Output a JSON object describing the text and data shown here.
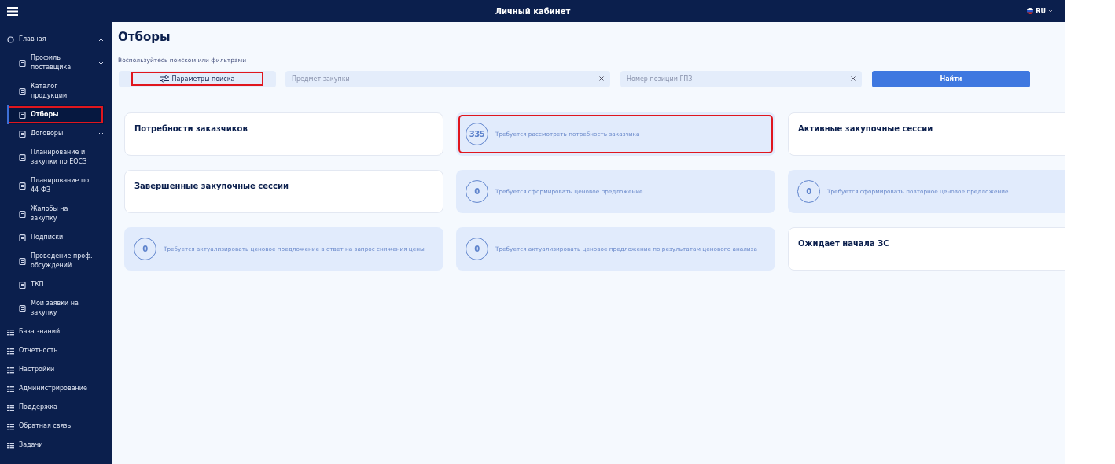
{
  "header": {
    "title": "Личный кабинет",
    "language": "RU"
  },
  "sidebar": {
    "items": [
      {
        "label": "Главная",
        "expanded": true,
        "selected": false,
        "highlighted": false,
        "children": [
          {
            "label": "Профиль поставщика",
            "expanded": false,
            "selected": false,
            "highlighted": false
          },
          {
            "label": "Каталог продукции",
            "selected": false,
            "highlighted": false
          },
          {
            "label": "Отборы",
            "selected": true,
            "highlighted": true
          },
          {
            "label": "Договоры",
            "expanded": false,
            "selected": false,
            "highlighted": false
          },
          {
            "label": "Планирование и закупки по ЕОСЗ",
            "selected": false,
            "highlighted": false
          },
          {
            "label": "Планирование по 44-ФЗ",
            "selected": false,
            "highlighted": false
          },
          {
            "label": "Жалобы на закупку",
            "selected": false,
            "highlighted": false
          },
          {
            "label": "Подписки",
            "selected": false,
            "highlighted": false
          },
          {
            "label": "Проведение проф. обсуждений",
            "selected": false,
            "highlighted": false
          },
          {
            "label": "ТКП",
            "selected": false,
            "highlighted": false
          },
          {
            "label": "Мои заявки на закупку",
            "selected": false,
            "highlighted": false
          }
        ]
      },
      {
        "label": "База знаний",
        "selected": false,
        "highlighted": false
      },
      {
        "label": "Отчетность",
        "selected": false,
        "highlighted": false
      },
      {
        "label": "Настройки",
        "selected": false,
        "highlighted": false
      },
      {
        "label": "Администрирование",
        "selected": false,
        "highlighted": false
      },
      {
        "label": "Поддержка",
        "selected": false,
        "highlighted": false
      },
      {
        "label": "Обратная связь",
        "selected": false,
        "highlighted": false
      },
      {
        "label": "Задачи",
        "selected": false,
        "highlighted": false
      }
    ]
  },
  "page": {
    "title": "Отборы",
    "hint": "Воспользуйтесь поиском или фильтрами"
  },
  "search": {
    "params_button": {
      "label": "Параметры поиска",
      "highlighted": true
    },
    "fields": [
      {
        "placeholder": "Предмет закупки"
      },
      {
        "placeholder": "Номер позиции ГПЗ"
      }
    ],
    "submit": "Найти"
  },
  "cards": [
    {
      "kind": "title",
      "title": "Потребности заказчиков",
      "highlighted": false
    },
    {
      "kind": "counter",
      "count": "335",
      "text": "Требуется рассмотреть потребность заказчика",
      "highlighted": true
    },
    {
      "kind": "title",
      "title": "Активные закупочные сессии",
      "highlighted": false
    },
    {
      "kind": "title",
      "title": "Завершенные закупочные сессии",
      "highlighted": false
    },
    {
      "kind": "counter",
      "count": "0",
      "text": "Требуется сформировать ценовое предложение",
      "highlighted": false
    },
    {
      "kind": "counter",
      "count": "0",
      "text": "Требуется сформировать повторное ценовое предложение",
      "highlighted": false
    },
    {
      "kind": "counter",
      "count": "0",
      "text": "Требуется актуализировать ценовое предложение в ответ на запрос снижения цены",
      "highlighted": false
    },
    {
      "kind": "counter",
      "count": "0",
      "text": "Требуется актуализировать ценовое предложение по результатам ценового анализа",
      "highlighted": false
    },
    {
      "kind": "title",
      "title": "Ожидает начала ЗС",
      "highlighted": false
    }
  ]
}
